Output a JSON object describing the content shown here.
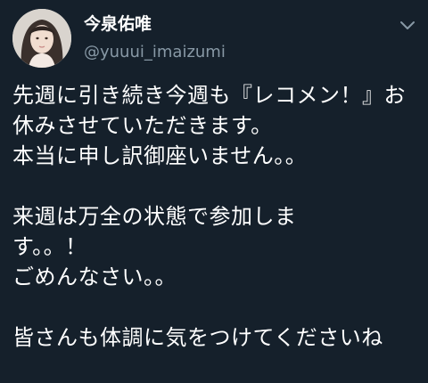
{
  "tweet": {
    "author": {
      "display_name": "今泉佑唯",
      "handle": "@yuuui_imaizumi",
      "avatar_icon": "profile-photo"
    },
    "menu_icon": "chevron-down-icon",
    "text": "先週に引き続き今週も『レコメン！』お休みさせていただきます。\n本当に申し訳御座いません。。\n\n来週は万全の状態で参加しま\nす。。！\nごめんなさい。。\n\n皆さんも体調に気をつけてくださいね"
  },
  "colors": {
    "background": "#15202b",
    "text_primary": "#ffffff",
    "text_secondary": "#8899a6"
  }
}
